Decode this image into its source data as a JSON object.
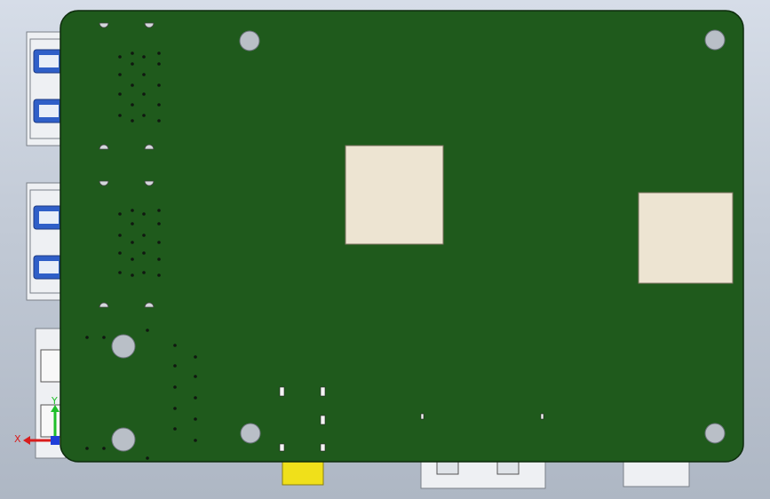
{
  "view": {
    "background_top": "#d6dde8",
    "background_bottom": "#aeb7c4",
    "board_color": "#1f5a1c",
    "pad_color": "#ede4d2",
    "usb_accent": "#2f5fc8",
    "audio_jack_color": "#f0e01a"
  },
  "triad": {
    "x_label": "X",
    "y_label": "Y",
    "x_color": "#d81c1c",
    "y_color": "#1fbf2a",
    "z_color": "#1f3fd8"
  }
}
